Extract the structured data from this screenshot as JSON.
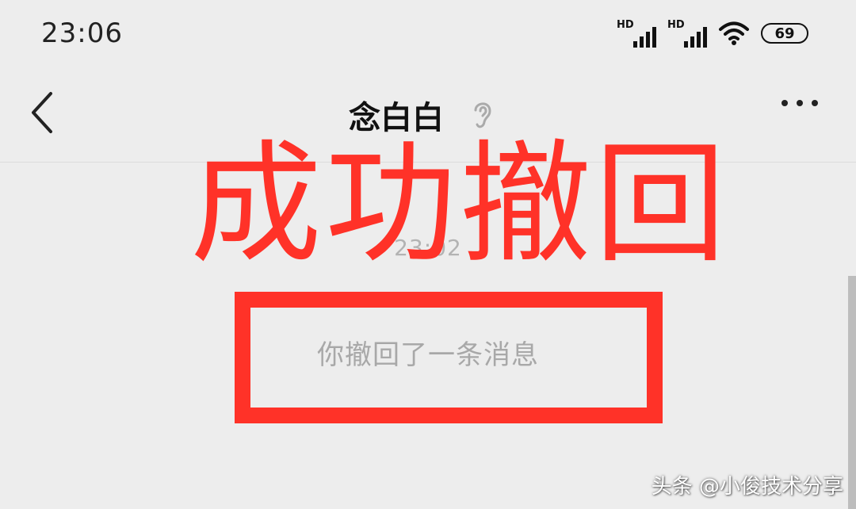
{
  "status_bar": {
    "time": "23:06",
    "signal1_label": "HD",
    "signal2_label": "HD",
    "battery": "69",
    "icons": [
      "signal-icon",
      "signal-icon",
      "wifi-icon",
      "battery-icon"
    ]
  },
  "nav": {
    "title": "念白白",
    "title_icon": "ear-icon",
    "back_icon": "chevron-left-icon",
    "more_icon": "more-dots-icon"
  },
  "chat": {
    "timestamp": "23:02",
    "recall_notice": "你撤回了一条消息"
  },
  "overlay": {
    "title": "成功撤回",
    "color": "#ff3228"
  },
  "watermark": "头条 @小俊技术分享"
}
